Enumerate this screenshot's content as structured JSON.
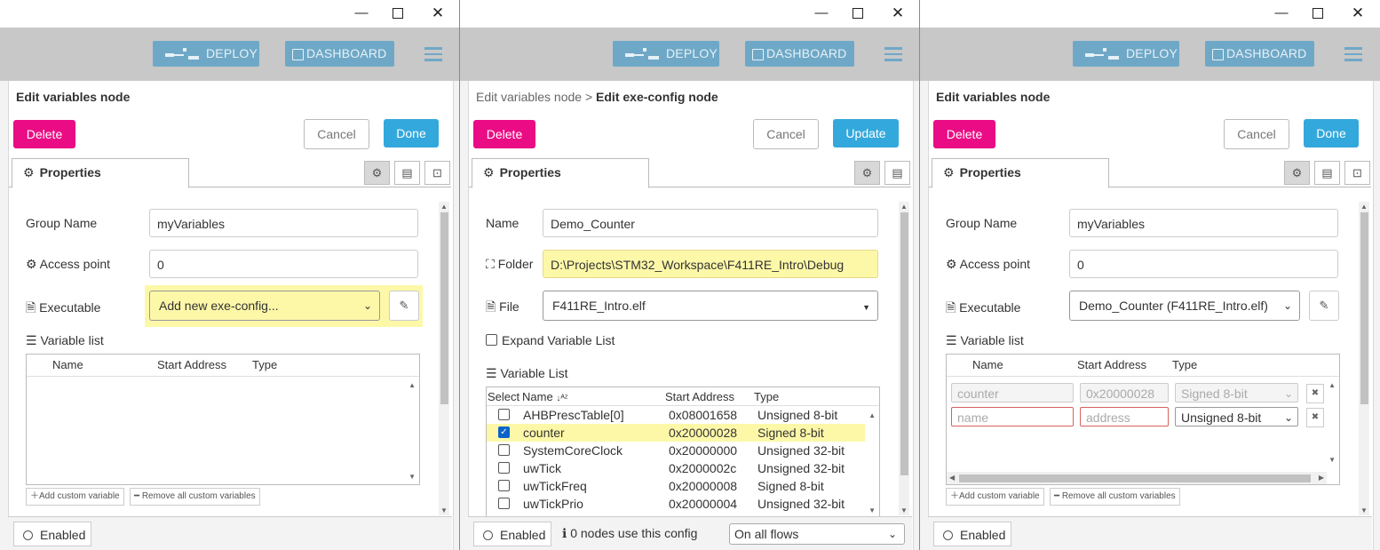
{
  "header": {
    "deploy_label": "DEPLOY",
    "dashboard_label": "DASHBOARD"
  },
  "window_controls": {
    "minimize": "—",
    "maximize": "☐",
    "close": "✕"
  },
  "panels": [
    {
      "title": "Edit variables node",
      "buttons": {
        "delete": "Delete",
        "cancel": "Cancel",
        "done": "Done"
      },
      "tab": "Properties",
      "group_name_label": "Group Name",
      "group_name_value": "myVariables",
      "access_point_label": "Access point",
      "access_point_value": "0",
      "executable_label": "Executable",
      "executable_value": "Add new exe-config...",
      "variable_list_label": "Variable list",
      "columns": [
        "Name",
        "Start Address",
        "Type"
      ],
      "add_custom": "Add custom variable",
      "remove_all": "Remove all custom variables",
      "enabled_label": "Enabled"
    },
    {
      "breadcrumb_parent": "Edit variables node",
      "breadcrumb_sep": ">",
      "title": "Edit exe-config node",
      "buttons": {
        "delete": "Delete",
        "cancel": "Cancel",
        "update": "Update"
      },
      "tab": "Properties",
      "name_label": "Name",
      "name_value": "Demo_Counter",
      "folder_label": "Folder",
      "folder_value": "D:\\Projects\\STM32_Workspace\\F411RE_Intro\\Debug",
      "file_label": "File",
      "file_value": "F411RE_Intro.elf",
      "expand_label": "Expand Variable List",
      "variable_list_label": "Variable List",
      "columns": [
        "Select",
        "Name",
        "Start Address",
        "Type"
      ],
      "rows": [
        {
          "name": "AHBPrescTable[0]",
          "address": "0x08001658",
          "type": "Unsigned 8-bit",
          "checked": false
        },
        {
          "name": "counter",
          "address": "0x20000028",
          "type": "Signed 8-bit",
          "checked": true
        },
        {
          "name": "SystemCoreClock",
          "address": "0x20000000",
          "type": "Unsigned 32-bit",
          "checked": false
        },
        {
          "name": "uwTick",
          "address": "0x2000002c",
          "type": "Unsigned 32-bit",
          "checked": false
        },
        {
          "name": "uwTickFreq",
          "address": "0x20000008",
          "type": "Signed 8-bit",
          "checked": false
        },
        {
          "name": "uwTickPrio",
          "address": "0x20000004",
          "type": "Unsigned 32-bit",
          "checked": false
        }
      ],
      "enabled_label": "Enabled",
      "usage_text": "0 nodes use this config",
      "flows_select": "On all flows"
    },
    {
      "title": "Edit variables node",
      "buttons": {
        "delete": "Delete",
        "cancel": "Cancel",
        "done": "Done"
      },
      "tab": "Properties",
      "group_name_label": "Group Name",
      "group_name_value": "myVariables",
      "access_point_label": "Access point",
      "access_point_value": "0",
      "executable_label": "Executable",
      "executable_value": "Demo_Counter (F411RE_Intro.elf)",
      "variable_list_label": "Variable list",
      "columns": [
        "Name",
        "Start Address",
        "Type"
      ],
      "rows": [
        {
          "name": "counter",
          "address": "0x20000028",
          "type": "Signed 8-bit"
        }
      ],
      "new_row": {
        "name_placeholder": "name",
        "address_placeholder": "address",
        "type": "Unsigned 8-bit"
      },
      "add_custom": "Add custom variable",
      "remove_all": "Remove all custom variables",
      "enabled_label": "Enabled"
    }
  ]
}
